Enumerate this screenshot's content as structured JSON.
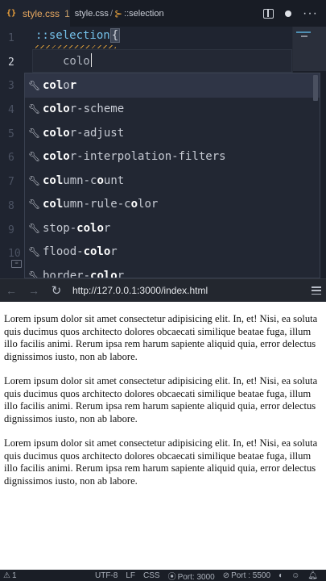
{
  "editor": {
    "tab": {
      "file_icon": "{}",
      "filename": "style.css",
      "problems_count": "1",
      "breadcrumb": [
        "style.css",
        "::selection"
      ]
    },
    "line_numbers": [
      "1",
      "2",
      "3",
      "4",
      "5",
      "6",
      "7",
      "8",
      "9",
      "10"
    ],
    "code": {
      "line1_selector": "::selection",
      "line1_brace": "{",
      "line2_text": "colo"
    },
    "suggestions": [
      {
        "match": "col",
        "rest1": "o",
        "mid": "r",
        "label": "color"
      },
      {
        "label": "color-scheme"
      },
      {
        "label": "color-adjust"
      },
      {
        "label": "color-interpolation-filters"
      },
      {
        "label": "column-count"
      },
      {
        "label": "column-rule-color"
      },
      {
        "label": "stop-color"
      },
      {
        "label": "flood-color"
      },
      {
        "label": "border-color"
      }
    ]
  },
  "browser": {
    "back_icon": "←",
    "forward_icon": "→",
    "reload_icon": "↻",
    "url": "http://127.0.0.1:3000/index.html"
  },
  "page": {
    "paragraphs": [
      "Lorem ipsum dolor sit amet consectetur adipisicing elit. In, et! Nisi, ea soluta quis ducimus quos architecto dolores obcaecati similique beatae fuga, illum illo facilis animi. Rerum ipsa rem harum sapiente aliquid quia, error delectus dignissimos iusto, non ab labore.",
      "Lorem ipsum dolor sit amet consectetur adipisicing elit. In, et! Nisi, ea soluta quis ducimus quos architecto dolores obcaecati similique beatae fuga, illum illo facilis animi. Rerum ipsa rem harum sapiente aliquid quia, error delectus dignissimos iusto, non ab labore.",
      "Lorem ipsum dolor sit amet consectetur adipisicing elit. In, et! Nisi, ea soluta quis ducimus quos architecto dolores obcaecati similique beatae fuga, illum illo facilis animi. Rerum ipsa rem harum sapiente aliquid quia, error delectus dignissimos iusto, non ab labore."
    ]
  },
  "statusbar": {
    "warnings": "1",
    "encoding": "UTF-8",
    "eol": "LF",
    "language": "CSS",
    "port_live": "Port: 3000",
    "port_other": "Port : 5500"
  },
  "colors": {
    "editor_bg": "#1f2430",
    "selector": "#74c0e9",
    "accent_orange": "#e7a860"
  }
}
